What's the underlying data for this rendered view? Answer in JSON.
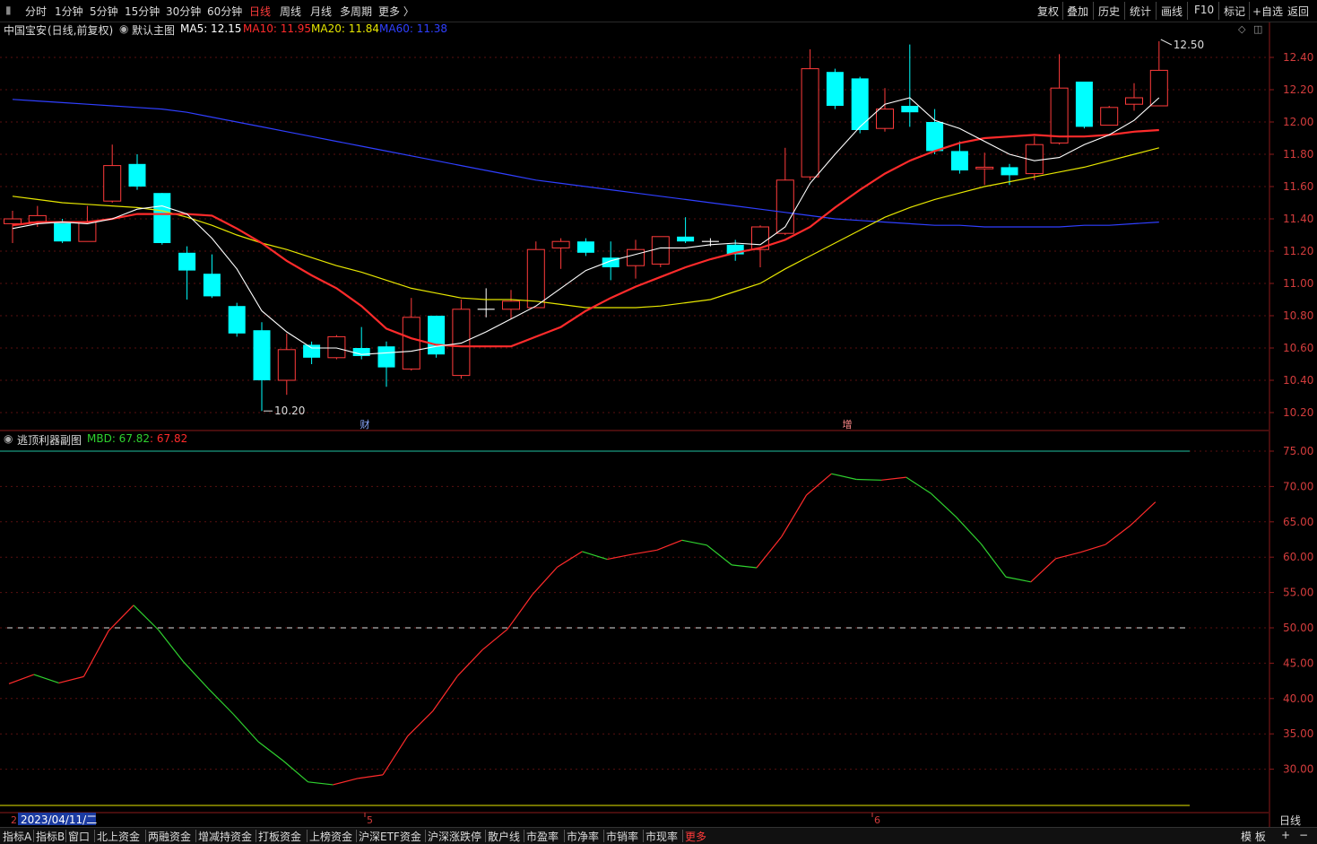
{
  "toolbar": {
    "periods": [
      "分时",
      "1分钟",
      "5分钟",
      "15分钟",
      "30分钟",
      "60分钟",
      "日线",
      "周线",
      "月线",
      "多周期",
      "更多 〉"
    ],
    "active_period": "日线",
    "right_tools": [
      "复权",
      "叠加",
      "历史",
      "统计",
      "画线",
      "F10",
      "标记",
      "+自选",
      "返回"
    ]
  },
  "stock": {
    "name": "中国宝安",
    "mode": "(日线,前复权)",
    "main_label": "默认主图"
  },
  "ma_legend": [
    {
      "label": "MA5: 12.15",
      "color": "#ffffff"
    },
    {
      "label": "MA10: 11.95",
      "color": "#ff2b2b"
    },
    {
      "label": "MA20: 11.84",
      "color": "#e6e600"
    },
    {
      "label": "MA60: 11.38",
      "color": "#2f3fff"
    }
  ],
  "sub_indicator": {
    "name": "逃顶利器副图",
    "mbd_label": "MBD: 67.82",
    "mbd_value": ": 67.82"
  },
  "annotations": {
    "max_label": "12.50",
    "min_label": "10.20",
    "event_cai": "财",
    "event_zeng": "增"
  },
  "x_axis": {
    "date_cursor": "2023/04/11/二",
    "month_5": "5",
    "month_6": "6",
    "first_digit": "2",
    "period_label": "日线"
  },
  "bottom_tabs": [
    "指标A",
    "指标B",
    "窗口",
    "北上资金",
    "两融资金",
    "增减持资金",
    "打板资金",
    "上榜资金",
    "沪深ETF资金",
    "沪深涨跌停",
    "散户线",
    "市盈率",
    "市净率",
    "市销率",
    "市现率",
    "更多"
  ],
  "bottom_right": [
    "模 板",
    "+",
    "−"
  ],
  "chart_data": {
    "type": "candlestick",
    "price_axis": {
      "min": 10.2,
      "max": 12.4,
      "ticks": [
        10.2,
        10.4,
        10.6,
        10.8,
        11.0,
        11.2,
        11.4,
        11.6,
        11.8,
        12.0,
        12.2,
        12.4
      ]
    },
    "candles": [
      {
        "o": 11.37,
        "c": 11.4,
        "h": 11.45,
        "l": 11.25
      },
      {
        "o": 11.38,
        "c": 11.42,
        "h": 11.48,
        "l": 11.35
      },
      {
        "o": 11.38,
        "c": 11.26,
        "h": 11.4,
        "l": 11.25
      },
      {
        "o": 11.26,
        "c": 11.38,
        "h": 11.48,
        "l": 11.26
      },
      {
        "o": 11.51,
        "c": 11.73,
        "h": 11.86,
        "l": 11.5
      },
      {
        "o": 11.74,
        "c": 11.6,
        "h": 11.8,
        "l": 11.58
      },
      {
        "o": 11.56,
        "c": 11.25,
        "h": 11.56,
        "l": 11.24
      },
      {
        "o": 11.19,
        "c": 11.08,
        "h": 11.23,
        "l": 10.9
      },
      {
        "o": 11.06,
        "c": 10.92,
        "h": 11.18,
        "l": 10.91
      },
      {
        "o": 10.86,
        "c": 10.69,
        "h": 10.88,
        "l": 10.67
      },
      {
        "o": 10.71,
        "c": 10.4,
        "h": 10.76,
        "l": 10.21
      },
      {
        "o": 10.4,
        "c": 10.59,
        "h": 10.69,
        "l": 10.31
      },
      {
        "o": 10.62,
        "c": 10.54,
        "h": 10.64,
        "l": 10.5
      },
      {
        "o": 10.54,
        "c": 10.67,
        "h": 10.68,
        "l": 10.53
      },
      {
        "o": 10.6,
        "c": 10.55,
        "h": 10.73,
        "l": 10.53
      },
      {
        "o": 10.61,
        "c": 10.48,
        "h": 10.64,
        "l": 10.36
      },
      {
        "o": 10.47,
        "c": 10.79,
        "h": 10.91,
        "l": 10.46
      },
      {
        "o": 10.8,
        "c": 10.56,
        "h": 10.8,
        "l": 10.54
      },
      {
        "o": 10.43,
        "c": 10.84,
        "h": 10.9,
        "l": 10.41
      },
      {
        "o": 10.84,
        "c": 10.84,
        "h": 10.97,
        "l": 10.79
      },
      {
        "o": 10.84,
        "c": 10.89,
        "h": 10.96,
        "l": 10.78
      },
      {
        "o": 10.85,
        "c": 11.21,
        "h": 11.26,
        "l": 10.85
      },
      {
        "o": 11.22,
        "c": 11.26,
        "h": 11.28,
        "l": 11.09
      },
      {
        "o": 11.26,
        "c": 11.19,
        "h": 11.28,
        "l": 11.17
      },
      {
        "o": 11.16,
        "c": 11.1,
        "h": 11.26,
        "l": 11.02
      },
      {
        "o": 11.11,
        "c": 11.21,
        "h": 11.27,
        "l": 11.03
      },
      {
        "o": 11.12,
        "c": 11.29,
        "h": 11.29,
        "l": 11.1
      },
      {
        "o": 11.29,
        "c": 11.26,
        "h": 11.41,
        "l": 11.25
      },
      {
        "o": 11.26,
        "c": 11.26,
        "h": 11.28,
        "l": 11.23
      },
      {
        "o": 11.24,
        "c": 11.18,
        "h": 11.27,
        "l": 11.14
      },
      {
        "o": 11.21,
        "c": 11.35,
        "h": 11.36,
        "l": 11.1
      },
      {
        "o": 11.31,
        "c": 11.64,
        "h": 11.84,
        "l": 11.3
      },
      {
        "o": 11.66,
        "c": 12.33,
        "h": 12.45,
        "l": 11.64
      },
      {
        "o": 12.31,
        "c": 12.1,
        "h": 12.33,
        "l": 12.08
      },
      {
        "o": 12.27,
        "c": 11.95,
        "h": 12.28,
        "l": 11.93
      },
      {
        "o": 11.96,
        "c": 12.08,
        "h": 12.21,
        "l": 11.94
      },
      {
        "o": 12.1,
        "c": 12.06,
        "h": 12.48,
        "l": 11.97
      },
      {
        "o": 12.0,
        "c": 11.82,
        "h": 12.08,
        "l": 11.8
      },
      {
        "o": 11.82,
        "c": 11.7,
        "h": 11.88,
        "l": 11.68
      },
      {
        "o": 11.71,
        "c": 11.72,
        "h": 11.81,
        "l": 11.61
      },
      {
        "o": 11.72,
        "c": 11.67,
        "h": 11.74,
        "l": 11.61
      },
      {
        "o": 11.68,
        "c": 11.86,
        "h": 11.91,
        "l": 11.64
      },
      {
        "o": 11.87,
        "c": 12.21,
        "h": 12.42,
        "l": 11.86
      },
      {
        "o": 12.25,
        "c": 11.97,
        "h": 12.25,
        "l": 11.96
      },
      {
        "o": 11.98,
        "c": 12.09,
        "h": 12.1,
        "l": 11.98
      },
      {
        "o": 12.11,
        "c": 12.15,
        "h": 12.24,
        "l": 12.07
      },
      {
        "o": 12.1,
        "c": 12.32,
        "h": 12.5,
        "l": 12.1
      }
    ],
    "ma5": [
      11.34,
      11.37,
      11.38,
      11.37,
      11.4,
      11.46,
      11.48,
      11.43,
      11.28,
      11.09,
      10.83,
      10.7,
      10.6,
      10.6,
      10.56,
      10.57,
      10.58,
      10.61,
      10.63,
      10.7,
      10.78,
      10.86,
      10.97,
      11.08,
      11.14,
      11.18,
      11.22,
      11.22,
      11.24,
      11.25,
      11.24,
      11.35,
      11.62,
      11.8,
      11.97,
      12.11,
      12.15,
      12.01,
      11.96,
      11.88,
      11.8,
      11.76,
      11.78,
      11.86,
      11.92,
      12.01,
      12.15
    ],
    "ma10": [
      11.36,
      11.38,
      11.38,
      11.38,
      11.4,
      11.43,
      11.43,
      11.43,
      11.42,
      11.34,
      11.25,
      11.14,
      11.05,
      10.97,
      10.86,
      10.72,
      10.66,
      10.62,
      10.61,
      10.61,
      10.61,
      10.67,
      10.73,
      10.83,
      10.91,
      10.98,
      11.04,
      11.1,
      11.15,
      11.19,
      11.22,
      11.27,
      11.35,
      11.47,
      11.58,
      11.68,
      11.76,
      11.82,
      11.87,
      11.9,
      11.91,
      11.92,
      11.91,
      11.91,
      11.92,
      11.94,
      11.95
    ],
    "ma20": [
      11.54,
      11.52,
      11.5,
      11.49,
      11.48,
      11.47,
      11.45,
      11.41,
      11.36,
      11.3,
      11.25,
      11.21,
      11.16,
      11.11,
      11.07,
      11.02,
      10.97,
      10.94,
      10.91,
      10.9,
      10.9,
      10.89,
      10.87,
      10.85,
      10.85,
      10.85,
      10.86,
      10.88,
      10.9,
      10.95,
      11.0,
      11.09,
      11.17,
      11.25,
      11.33,
      11.41,
      11.47,
      11.52,
      11.56,
      11.6,
      11.63,
      11.66,
      11.69,
      11.72,
      11.76,
      11.8,
      11.84
    ],
    "ma60": [
      12.14,
      12.13,
      12.12,
      12.11,
      12.1,
      12.09,
      12.08,
      12.06,
      12.03,
      12.0,
      11.97,
      11.94,
      11.91,
      11.88,
      11.85,
      11.82,
      11.79,
      11.76,
      11.73,
      11.7,
      11.67,
      11.64,
      11.62,
      11.6,
      11.58,
      11.56,
      11.54,
      11.52,
      11.5,
      11.48,
      11.46,
      11.44,
      11.42,
      11.4,
      11.39,
      11.38,
      11.37,
      11.36,
      11.36,
      11.35,
      11.35,
      11.35,
      11.35,
      11.36,
      11.36,
      11.37,
      11.38
    ],
    "mbd_axis": {
      "min": 25.0,
      "max": 75.0,
      "ticks": [
        30,
        35,
        40,
        45,
        50,
        55,
        60,
        65,
        70,
        75
      ]
    },
    "mbd": [
      42.1,
      43.4,
      42.2,
      43.1,
      49.6,
      53.2,
      49.7,
      45.2,
      41.4,
      37.8,
      33.9,
      31.2,
      28.2,
      27.8,
      28.7,
      29.2,
      34.7,
      38.2,
      43.2,
      46.9,
      49.8,
      54.7,
      58.6,
      60.8,
      59.7,
      60.4,
      61.0,
      62.4,
      61.7,
      58.9,
      58.5,
      62.9,
      68.8,
      71.8,
      71.0,
      70.9,
      71.3,
      69.0,
      65.7,
      61.9,
      57.2,
      56.5,
      59.8,
      60.7,
      61.8,
      64.5,
      67.8
    ],
    "mbd_upper_line": 75.0,
    "mbd_mid_line": 50.0,
    "mbd_lower_line": 25.0
  }
}
